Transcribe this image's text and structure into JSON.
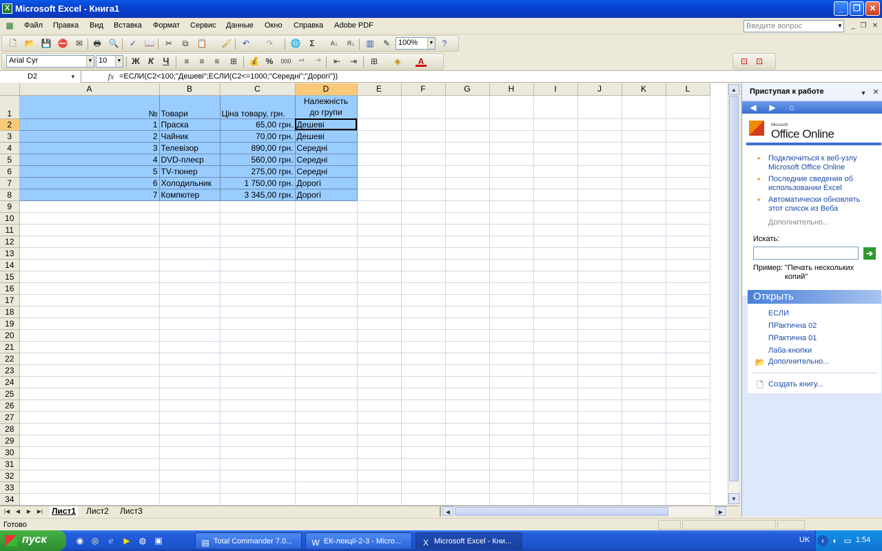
{
  "window": {
    "title": "Microsoft Excel - Книга1"
  },
  "menu": {
    "items": [
      "Файл",
      "Правка",
      "Вид",
      "Вставка",
      "Формат",
      "Сервис",
      "Данные",
      "Окно",
      "Справка",
      "Adobe PDF"
    ],
    "ask_placeholder": "Введите вопрос"
  },
  "toolbar": {
    "zoom": "100%"
  },
  "format_toolbar": {
    "font": "Arial Cyr",
    "size": "10",
    "bold": "Ж",
    "italic": "К",
    "underline": "Ч",
    "percent": "%",
    "thousands": "000"
  },
  "formula_bar": {
    "name_box": "D2",
    "fx": "fx",
    "formula": "=ЕСЛИ(C2<100;\"Дешеві\";ЕСЛИ(C2<=1000;\"Середні\";\"Дорогі\"))"
  },
  "sheet": {
    "columns": [
      "A",
      "B",
      "C",
      "D",
      "E",
      "F",
      "G",
      "H",
      "I",
      "J",
      "K",
      "L"
    ],
    "header_row": {
      "a": "№",
      "b": "Товари",
      "c": "Ціна товару, грн.",
      "d1": "Належність",
      "d2": "до групи"
    },
    "rows": [
      {
        "n": "2",
        "a": "1",
        "b": "Праска",
        "c": "65,00 грн.",
        "d": "Дешеві"
      },
      {
        "n": "3",
        "a": "2",
        "b": "Чайник",
        "c": "70,00 грн.",
        "d": "Дешеві"
      },
      {
        "n": "4",
        "a": "3",
        "b": "Телевізор",
        "c": "890,00 грн.",
        "d": "Середні"
      },
      {
        "n": "5",
        "a": "4",
        "b": "DVD-плеєр",
        "c": "560,00 грн.",
        "d": "Середні"
      },
      {
        "n": "6",
        "a": "5",
        "b": "TV-тюнер",
        "c": "275,00 грн.",
        "d": "Середні"
      },
      {
        "n": "7",
        "a": "6",
        "b": "Холодильник",
        "c": "1 750,00 грн.",
        "d": "Дорогі"
      },
      {
        "n": "8",
        "a": "7",
        "b": "Компютер",
        "c": "3 345,00 грн.",
        "d": "Дорогі"
      }
    ],
    "tabs": [
      "Лист1",
      "Лист2",
      "Лист3"
    ],
    "active_cell": "D2"
  },
  "status": {
    "text": "Готово"
  },
  "task_pane": {
    "title": "Приступая к работе",
    "brand_small": "Microsoft",
    "brand": "Office Online",
    "links": [
      "Подключиться к веб-узлу Microsoft Office Online",
      "Последние сведения об использовании Excel",
      "Автоматически обновлять этот список из Веба"
    ],
    "more": "Дополнительно...",
    "search_label": "Искать:",
    "example_label": "Пример:",
    "example_text": "\"Печать нескольких копий\"",
    "open_title": "Открыть",
    "recent": [
      "ЕСЛИ",
      "ПРактична 02",
      "ПРактична 01",
      "Лаба-кнопки"
    ],
    "open_more": "Дополнительно...",
    "create": "Создать книгу..."
  },
  "taskbar": {
    "start": "пуск",
    "tasks": [
      "Total Commander 7.0...",
      "ЕК-лекції-2-3 - Micro...",
      "Microsoft Excel - Кни..."
    ],
    "lang": "UK",
    "time": "1:54"
  }
}
